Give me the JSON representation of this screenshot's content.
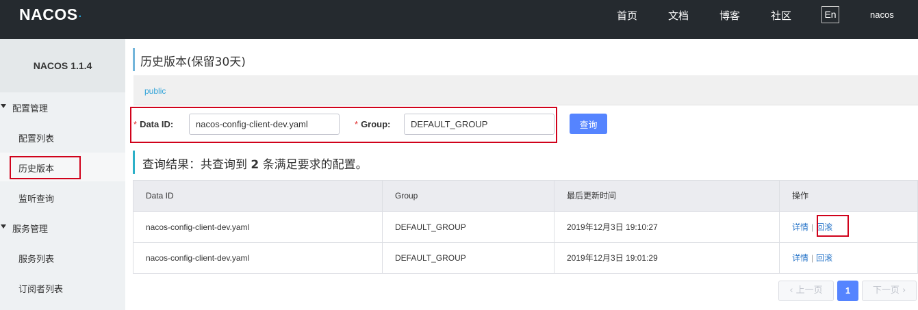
{
  "header": {
    "logo_text": "NACOS",
    "nav": [
      "首页",
      "文档",
      "博客",
      "社区"
    ],
    "lang_button": "En",
    "user": "nacos"
  },
  "sidebar": {
    "version": "NACOS 1.1.4",
    "groups": [
      {
        "label": "配置管理",
        "items": [
          "配置列表",
          "历史版本",
          "监听查询"
        ]
      },
      {
        "label": "服务管理",
        "items": [
          "服务列表",
          "订阅者列表"
        ]
      }
    ]
  },
  "main": {
    "title": "历史版本(保留30天)",
    "namespace": "public",
    "form": {
      "data_id_label": "Data ID:",
      "data_id_value": "nacos-config-client-dev.yaml",
      "group_label": "Group:",
      "group_value": "DEFAULT_GROUP",
      "required_mark": "*",
      "query_button": "查询"
    },
    "result": {
      "prefix": "查询结果：共查询到",
      "count": "2",
      "suffix": "条满足要求的配置。"
    },
    "table": {
      "columns": [
        "Data ID",
        "Group",
        "最后更新时间",
        "操作"
      ],
      "rows": [
        {
          "data_id": "nacos-config-client-dev.yaml",
          "group": "DEFAULT_GROUP",
          "time": "2019年12月3日 19:10:27",
          "detail": "详情",
          "sep": "|",
          "rollback": "回滚"
        },
        {
          "data_id": "nacos-config-client-dev.yaml",
          "group": "DEFAULT_GROUP",
          "time": "2019年12月3日 19:01:29",
          "detail": "详情",
          "sep": "|",
          "rollback": "回滚"
        }
      ]
    },
    "pagination": {
      "prev": "上一页",
      "current": "1",
      "next": "下一页"
    },
    "colors": {
      "header_bg": "#252a2f",
      "primary": "#5584ff",
      "link": "#2473c8",
      "annotation": "#d0021b"
    }
  }
}
